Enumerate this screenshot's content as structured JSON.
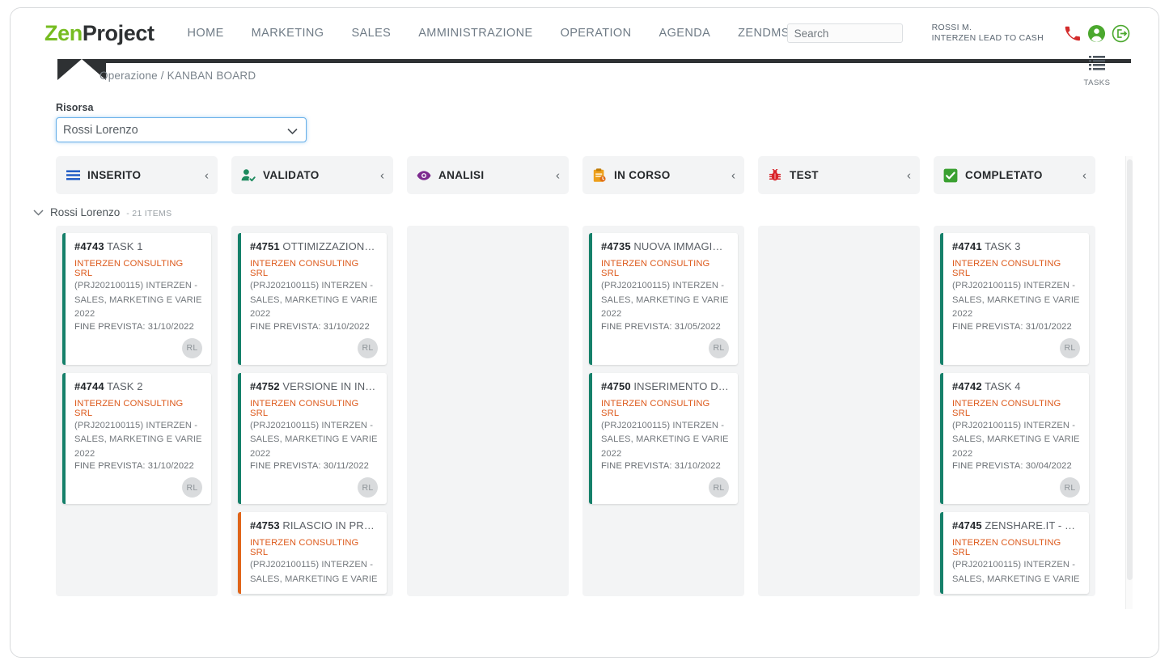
{
  "header": {
    "logo_zen": "Zen",
    "logo_project": "Project",
    "nav": [
      {
        "label": "HOME"
      },
      {
        "label": "MARKETING"
      },
      {
        "label": "SALES"
      },
      {
        "label": "AMMINISTRAZIONE"
      },
      {
        "label": "OPERATION"
      },
      {
        "label": "AGENDA"
      },
      {
        "label": "ZENDMS"
      }
    ],
    "search_placeholder": "Search",
    "search_value": "",
    "user_name": "ROSSI M.",
    "user_org": "INTERZEN LEAD TO CASH",
    "icons": [
      "phone-icon",
      "user-account-icon",
      "logout-icon"
    ],
    "colors": {
      "logo_green": "#76bc21",
      "logo_dark": "#2e3133",
      "phone_red": "#d32b2b",
      "account_green": "#4ba82e",
      "logout_green": "#4ba82e"
    }
  },
  "breadcrumb": {
    "text": "Operazione / KANBAN BOARD"
  },
  "tasks_button": {
    "label": "TASKS"
  },
  "filter": {
    "label": "Risorsa",
    "selected": "Rossi Lorenzo",
    "options": [
      "Rossi Lorenzo"
    ]
  },
  "group": {
    "chevron": "chevron-down-icon",
    "name": "Rossi Lorenzo",
    "count": "- 21 ITEMS"
  },
  "columns": [
    {
      "title": "INSERITO",
      "icon": "list-lines-icon",
      "icon_color": "#1a57c4",
      "collapse": "‹"
    },
    {
      "title": "VALIDATO",
      "icon": "user-check-icon",
      "icon_color": "#1d8a5e",
      "collapse": "‹"
    },
    {
      "title": "ANALISI",
      "icon": "eye-icon",
      "icon_color": "#7d2b8f",
      "collapse": "‹"
    },
    {
      "title": "IN CORSO",
      "icon": "clipboard-icon",
      "icon_color": "#eda01c",
      "collapse": "‹"
    },
    {
      "title": "TEST",
      "icon": "bug-icon",
      "icon_color": "#d8232a",
      "collapse": "‹"
    },
    {
      "title": "COMPLETATO",
      "icon": "check-square-icon",
      "icon_color": "#3aa031",
      "collapse": "‹"
    }
  ],
  "lanes": [
    {
      "column": "INSERITO",
      "cards": [
        {
          "id": "#4743",
          "title": "TASK 1",
          "client": "INTERZEN CONSULTING SRL",
          "project": "(PRJ202100115) INTERZEN - SALES, MARKETING E VARIE 2022",
          "due": "FINE PREVISTA: 31/10/2022",
          "avatar": "RL",
          "accent": "teal"
        },
        {
          "id": "#4744",
          "title": "TASK 2",
          "client": "INTERZEN CONSULTING SRL",
          "project": "(PRJ202100115) INTERZEN - SALES, MARKETING E VARIE 2022",
          "due": "FINE PREVISTA: 31/10/2022",
          "avatar": "RL",
          "accent": "teal"
        }
      ]
    },
    {
      "column": "VALIDATO",
      "cards": [
        {
          "id": "#4751",
          "title": "OTTIMIZZAZIONE CO...",
          "client": "INTERZEN CONSULTING SRL",
          "project": "(PRJ202100115) INTERZEN - SALES, MARKETING E VARIE 2022",
          "due": "FINE PREVISTA: 31/10/2022",
          "avatar": "RL",
          "accent": "teal"
        },
        {
          "id": "#4752",
          "title": "VERSIONE IN INGLESE",
          "client": "INTERZEN CONSULTING SRL",
          "project": "(PRJ202100115) INTERZEN - SALES, MARKETING E VARIE 2022",
          "due": "FINE PREVISTA: 30/11/2022",
          "avatar": "RL",
          "accent": "teal"
        },
        {
          "id": "#4753",
          "title": "RILASCIO IN PRODUZ...",
          "client": "INTERZEN CONSULTING SRL",
          "project": "(PRJ202100115) INTERZEN - SALES, MARKETING E VARIE",
          "due": "",
          "avatar": "",
          "accent": "orange"
        }
      ]
    },
    {
      "column": "ANALISI",
      "cards": []
    },
    {
      "column": "IN CORSO",
      "cards": [
        {
          "id": "#4735",
          "title": "NUOVA IMMAGINE C...",
          "client": "INTERZEN CONSULTING SRL",
          "project": "(PRJ202100115) INTERZEN - SALES, MARKETING E VARIE 2022",
          "due": "FINE PREVISTA: 31/05/2022",
          "avatar": "RL",
          "accent": "teal"
        },
        {
          "id": "#4750",
          "title": "INSERIMENTO DEI C...",
          "client": "INTERZEN CONSULTING SRL",
          "project": "(PRJ202100115) INTERZEN - SALES, MARKETING E VARIE 2022",
          "due": "FINE PREVISTA: 31/10/2022",
          "avatar": "RL",
          "accent": "teal"
        }
      ]
    },
    {
      "column": "TEST",
      "cards": []
    },
    {
      "column": "COMPLETATO",
      "cards": [
        {
          "id": "#4741",
          "title": "TASK 3",
          "client": "INTERZEN CONSULTING SRL",
          "project": "(PRJ202100115) INTERZEN - SALES, MARKETING E VARIE 2022",
          "due": "FINE PREVISTA: 31/01/2022",
          "avatar": "RL",
          "accent": "teal"
        },
        {
          "id": "#4742",
          "title": "TASK 4",
          "client": "INTERZEN CONSULTING SRL",
          "project": "(PRJ202100115) INTERZEN - SALES, MARKETING E VARIE 2022",
          "due": "FINE PREVISTA: 30/04/2022",
          "avatar": "RL",
          "accent": "teal"
        },
        {
          "id": "#4745",
          "title": "ZENSHARE.IT - PAGIN...",
          "client": "INTERZEN CONSULTING SRL",
          "project": "(PRJ202100115) INTERZEN - SALES, MARKETING E VARIE",
          "due": "",
          "avatar": "",
          "accent": "teal"
        }
      ]
    }
  ]
}
